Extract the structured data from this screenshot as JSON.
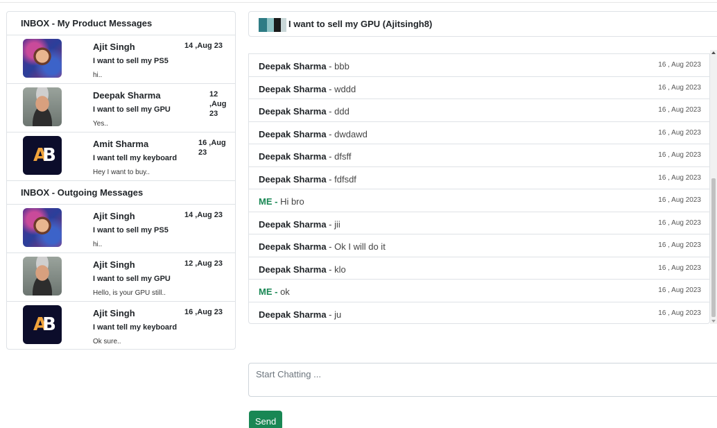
{
  "inbox": {
    "title": "INBOX - My Product Messages",
    "items": [
      {
        "name": "Ajit Singh",
        "subject": "I want to sell my PS5",
        "preview": "hi..",
        "date": "14 ,Aug 23",
        "avatar": "ajit-avatar"
      },
      {
        "name": "Deepak Sharma",
        "subject": "I want to sell my GPU",
        "preview": "Yes..",
        "date_lines": [
          "12",
          ",Aug",
          "23"
        ],
        "avatar": "deepak-avatar"
      },
      {
        "name": "Amit Sharma",
        "subject": "I want tell my keyboard",
        "preview": "Hey I want to buy..",
        "date_lines": [
          "16 ,Aug",
          "23"
        ],
        "avatar": "ab-logo"
      }
    ]
  },
  "outgoing": {
    "title": "INBOX - Outgoing Messages",
    "items": [
      {
        "name": "Ajit Singh",
        "subject": "I want to sell my PS5",
        "preview": "hi..",
        "date": "14 ,Aug 23",
        "avatar": "ajit-avatar"
      },
      {
        "name": "Ajit Singh",
        "subject": "I want to sell my GPU",
        "preview": "Hello, is your GPU still..",
        "date": "12 ,Aug 23",
        "avatar": "deepak-avatar"
      },
      {
        "name": "Ajit Singh",
        "subject": "I want tell my keyboard",
        "preview": "Ok sure..",
        "date": "16 ,Aug 23",
        "avatar": "ab-logo"
      }
    ]
  },
  "chat": {
    "title": "I want to sell my GPU (Ajitsingh8)",
    "messages": [
      {
        "sender": "Deepak Sharma",
        "text": "bbb",
        "date": "16 , Aug 2023",
        "me": false
      },
      {
        "sender": "Deepak Sharma",
        "text": "wddd",
        "date": "16 , Aug 2023",
        "me": false
      },
      {
        "sender": "Deepak Sharma",
        "text": "ddd",
        "date": "16 , Aug 2023",
        "me": false
      },
      {
        "sender": "Deepak Sharma",
        "text": "dwdawd",
        "date": "16 , Aug 2023",
        "me": false
      },
      {
        "sender": "Deepak Sharma",
        "text": "dfsff",
        "date": "16 , Aug 2023",
        "me": false
      },
      {
        "sender": "Deepak Sharma",
        "text": "fdfsdf",
        "date": "16 , Aug 2023",
        "me": false
      },
      {
        "sender": "ME",
        "text": "Hi bro",
        "date": "16 , Aug 2023",
        "me": true
      },
      {
        "sender": "Deepak Sharma",
        "text": "jii",
        "date": "16 , Aug 2023",
        "me": false
      },
      {
        "sender": "Deepak Sharma",
        "text": "Ok I will do it",
        "date": "16 , Aug 2023",
        "me": false
      },
      {
        "sender": "Deepak Sharma",
        "text": "klo",
        "date": "16 , Aug 2023",
        "me": false
      },
      {
        "sender": "ME",
        "text": "ok",
        "date": "16 , Aug 2023",
        "me": true
      },
      {
        "sender": "Deepak Sharma",
        "text": "ju",
        "date": "16 , Aug 2023",
        "me": false
      }
    ],
    "input_placeholder": "Start Chatting ...",
    "input_value": "",
    "send_label": "Send",
    "separator": " - "
  },
  "colors": {
    "accent_green": "#198754",
    "border": "#dee2e6"
  }
}
